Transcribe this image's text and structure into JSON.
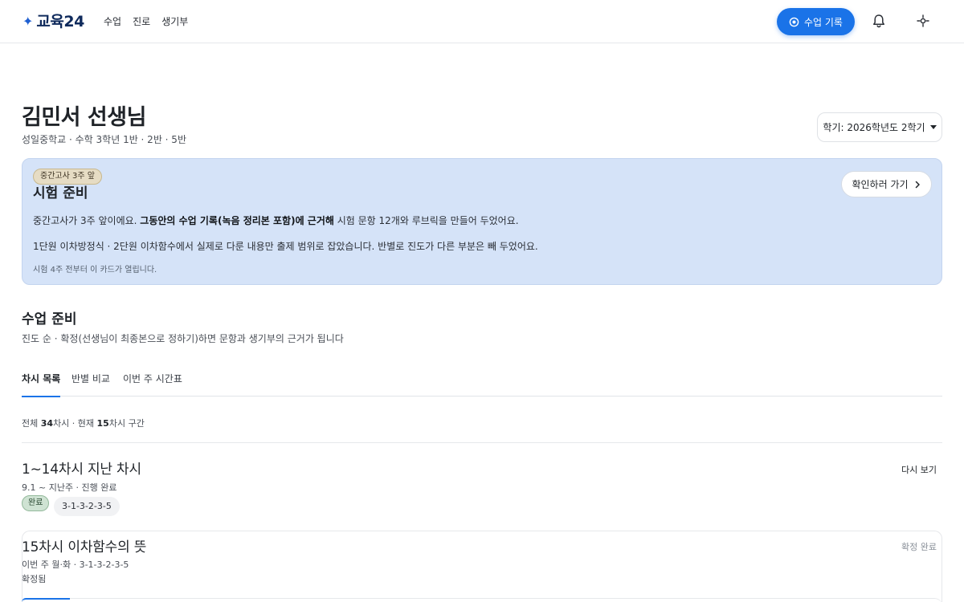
{
  "header": {
    "logo_text": "교육24",
    "nav": [
      "수업",
      "진로",
      "생기부"
    ],
    "record_button": "수업 기록"
  },
  "teacher": {
    "name": "김민서 선생님",
    "subtitle": "성일중학교 · 수학 3학년 1반 · 2반 · 5반"
  },
  "term_select": {
    "value": "학기: 2026학년도 2학기"
  },
  "exam_card": {
    "badge": "중간고사 3주 앞",
    "title": "시험 준비",
    "line1_pre": "중간고사가 3주 앞이에요. ",
    "line1_bold": "그동안의 수업 기록(녹음 정리본 포함)에 근거해",
    "line1_post": " 시험 문항 12개와 루브릭을 만들어 두었어요.",
    "line2": "1단원 이차방정식 · 2단원 이차함수에서 실제로 다룬 내용만 출제 범위로 잡았습니다. 반별로 진도가 다른 부분은 빼 두었어요.",
    "note": "시험 4주 전부터 이 카드가 열립니다.",
    "cta": "확인하러 가기"
  },
  "class_prep": {
    "title": "수업 준비",
    "desc": "진도 순 · 확정(선생님이 최종본으로 정하기)하면 문항과 생기부의 근거가 됩니다"
  },
  "tabs": [
    "차시 목록",
    "반별 비교",
    "이번 주 시간표"
  ],
  "summary": {
    "total_label": "전체 ",
    "total": "34",
    "total_unit": "차시 · 현재 ",
    "current": "15",
    "current_unit": "차시 구간"
  },
  "lessons": [
    {
      "title": "1~14차시 지난 차시",
      "meta": "9.1 ~ 지난주 · 진행 완료",
      "status_tag": "완료",
      "sequence": "3-1-3-2-3-5",
      "action": "다시 보기"
    },
    {
      "title": "15차시 이차함수의 뜻",
      "meta": "이번 주 월·화 · 3-1-3-2-3-5",
      "status": "확정됨",
      "action": "확정 완료"
    }
  ],
  "colors": {
    "accent": "#1a73e8",
    "exam_card_bg": "#d5e3f8",
    "done_tag_bg": "#cfe3d3"
  }
}
